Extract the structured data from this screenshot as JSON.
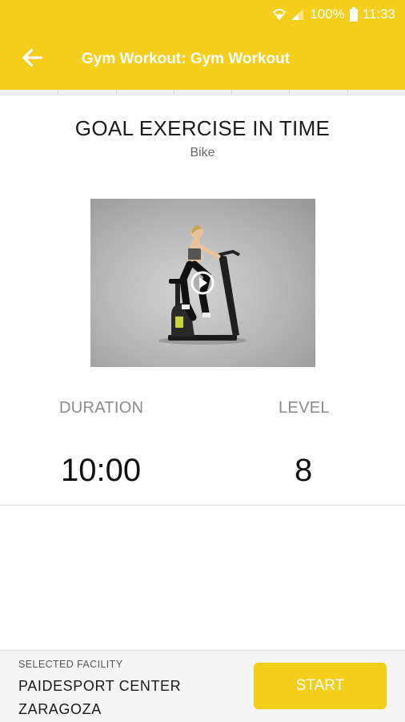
{
  "status_bar": {
    "battery": "100%",
    "time": "11:33"
  },
  "toolbar": {
    "title": "Gym Workout: Gym Workout",
    "back_icon": "arrow-left-icon"
  },
  "exercise": {
    "title": "GOAL EXERCISE IN TIME",
    "subtitle": "Bike",
    "video_icon": "play-icon"
  },
  "stats": {
    "duration_label": "DURATION",
    "duration_value": "10:00",
    "level_label": "LEVEL",
    "level_value": "8"
  },
  "footer": {
    "facility_label": "SELECTED FACILITY",
    "facility_name": "PAIDESPORT CENTER ZARAGOZA",
    "start_label": "START"
  },
  "colors": {
    "accent": "#F5CE1B",
    "background": "#FFFFFF"
  }
}
